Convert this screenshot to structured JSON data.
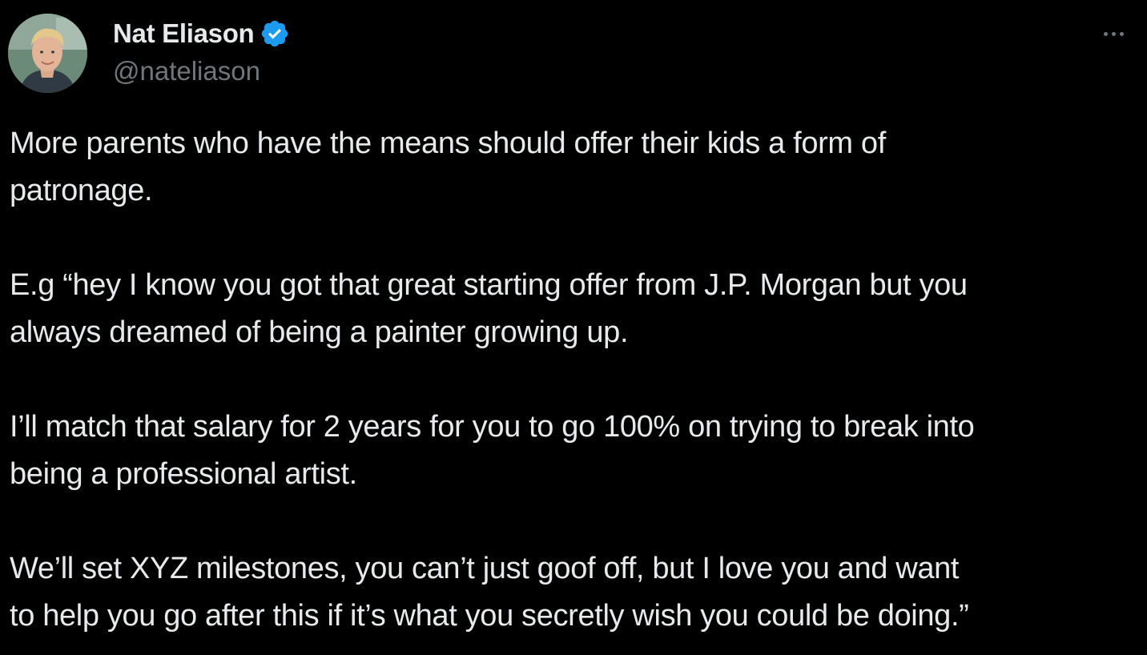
{
  "author": {
    "display_name": "Nat Eliason",
    "handle": "@nateliason",
    "verified": true,
    "verified_color": "#1d9bf0"
  },
  "more_menu": {
    "icon": "more-horizontal-icon"
  },
  "tweet": {
    "paragraphs": [
      "More parents who have the means should offer their kids a form of\npatronage.",
      "E.g “hey I know you got that great starting offer from J.P. Morgan but you\nalways dreamed of being a painter growing up.",
      "I’ll match that salary for 2 years for you to go 100% on trying to break into\nbeing a professional artist.",
      "We’ll set XYZ milestones, you can’t just goof off, but I love you and want\nto help you go after this if it’s what you secretly wish you could be doing.”"
    ]
  },
  "colors": {
    "background": "#000000",
    "primary_text": "#e7e9ea",
    "secondary_text": "#71767b"
  }
}
